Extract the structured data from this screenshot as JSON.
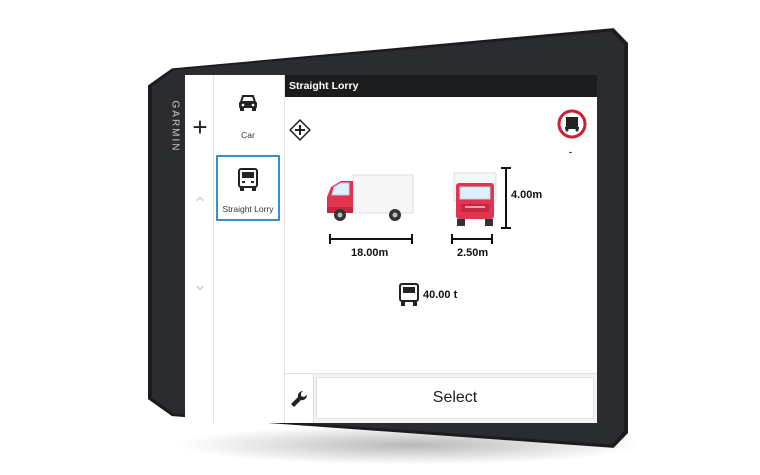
{
  "device": {
    "brand": "GARMIN"
  },
  "left_strip": {
    "add_icon": "plus-icon",
    "up_icon": "chevron-up-icon",
    "down_icon": "chevron-down-icon"
  },
  "profiles": {
    "items": [
      {
        "label": "Car",
        "icon": "car-icon",
        "selected": false
      },
      {
        "label": "Straight Lorry",
        "icon": "truck-front-icon",
        "selected": true
      }
    ]
  },
  "header": {
    "title": "Straight Lorry"
  },
  "vehicle": {
    "length": "18.00m",
    "width": "2.50m",
    "height": "4.00m",
    "weight": "40.00 t",
    "hazmat_icon": "hazmat-plus-icon",
    "restriction_icon": "no-trucks-sign-icon",
    "restriction_value": "-"
  },
  "bottom": {
    "settings_icon": "wrench-icon",
    "select_label": "Select"
  },
  "colors": {
    "truck_red": "#e0344f",
    "selection_blue": "#3a8fd0",
    "header_dark": "#1b1c1e",
    "sign_red": "#d0202e"
  }
}
